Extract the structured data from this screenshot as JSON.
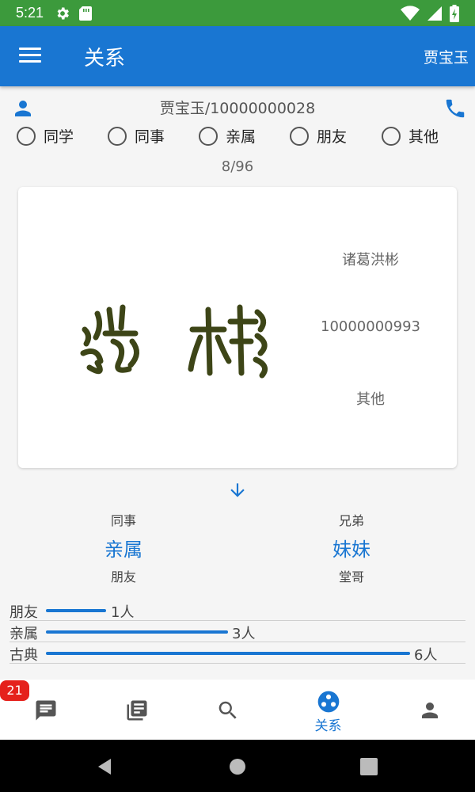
{
  "status_bar": {
    "time": "5:21"
  },
  "app_bar": {
    "title": "关系",
    "user": "贾宝玉"
  },
  "contact": {
    "title": "贾宝玉/10000000028"
  },
  "relation_options": [
    "同学",
    "同事",
    "亲属",
    "朋友",
    "其他"
  ],
  "counter": "8/96",
  "card": {
    "name": "诸葛洪彬",
    "number": "10000000993",
    "relation": "其他"
  },
  "relations": {
    "left": {
      "top": "同事",
      "main": "亲属",
      "bottom": "朋友"
    },
    "right": {
      "top": "兄弟",
      "main": "妹妹",
      "bottom": "堂哥"
    }
  },
  "stats": [
    {
      "label": "朋友",
      "count": 1,
      "value_text": "1人"
    },
    {
      "label": "亲属",
      "count": 3,
      "value_text": "3人"
    },
    {
      "label": "古典",
      "count": 6,
      "value_text": "6人"
    }
  ],
  "bottom_nav": {
    "badge": "21",
    "active_label": "关系",
    "icons": [
      "message-icon",
      "library-icon",
      "search-icon",
      "relation-icon",
      "person-icon"
    ]
  },
  "colors": {
    "primary": "#1976d2",
    "status_bar": "#3c9a3c",
    "badge": "#e5211c"
  }
}
